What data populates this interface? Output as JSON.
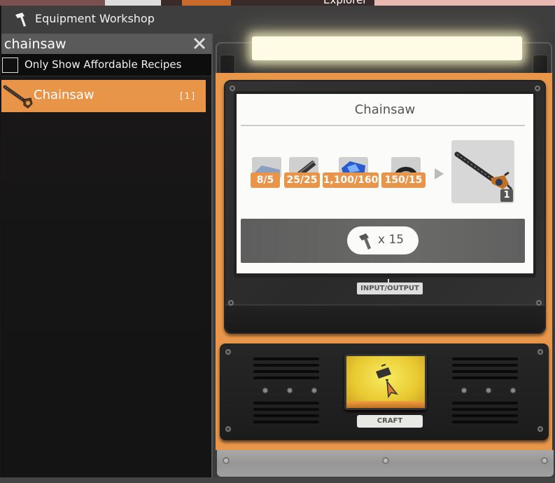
{
  "background": {
    "top_label": "Explorer"
  },
  "window": {
    "title": "Equipment Workshop",
    "title_icon": "hammer-icon"
  },
  "search": {
    "value": "chainsaw",
    "clear_icon": "close-icon"
  },
  "filter": {
    "label": "Only Show Affordable Recipes",
    "checked": false
  },
  "recipes": [
    {
      "name": "Chainsaw",
      "count": "[1]",
      "selected": true,
      "icon": "chainsaw-icon"
    }
  ],
  "detail": {
    "title": "Chainsaw",
    "ingredients": [
      {
        "icon": "metal-plate-icon",
        "have_need": "8/5"
      },
      {
        "icon": "metal-rod-icon",
        "have_need": "25/25"
      },
      {
        "icon": "blue-crystal-icon",
        "have_need": "1,100/160"
      },
      {
        "icon": "wire-coil-icon",
        "have_need": "150/15"
      }
    ],
    "output": {
      "icon": "chainsaw-icon",
      "quantity": "1"
    },
    "cost": {
      "icon": "hammer-icon",
      "text": "x 15"
    },
    "io_label": "INPUT/OUTPUT"
  },
  "craft": {
    "label": "CRAFT",
    "icon": "hammer-cursor-icon"
  },
  "colors": {
    "accent": "#e8954a",
    "craft_button": "#f0d840"
  }
}
